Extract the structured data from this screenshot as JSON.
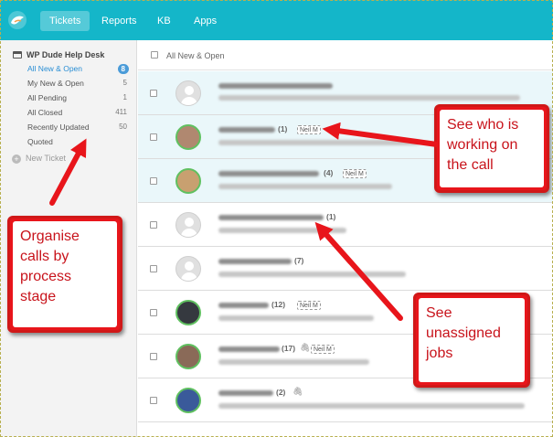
{
  "nav": {
    "tabs": [
      {
        "label": "Tickets"
      },
      {
        "label": "Reports"
      },
      {
        "label": "KB"
      },
      {
        "label": "Apps"
      }
    ]
  },
  "sidebar": {
    "helpdesk_name": "WP Dude Help Desk",
    "items": [
      {
        "label": "All New & Open",
        "count": "8"
      },
      {
        "label": "My New & Open",
        "count": "5"
      },
      {
        "label": "All Pending",
        "count": "1"
      },
      {
        "label": "All Closed",
        "count": "411"
      },
      {
        "label": "Recently Updated",
        "count": "50"
      },
      {
        "label": "Quoted",
        "count": ""
      }
    ],
    "new_ticket_label": "New Ticket"
  },
  "list": {
    "header_label": "All New & Open",
    "rows": [
      {
        "count": "",
        "agent": ""
      },
      {
        "count": "(1)",
        "agent": "Neil M"
      },
      {
        "count": "(4)",
        "agent": "Neil M"
      },
      {
        "count": "(1)",
        "agent": ""
      },
      {
        "count": "(7)",
        "agent": ""
      },
      {
        "count": "(12)",
        "agent": "Neil M"
      },
      {
        "count": "(17)",
        "agent": "Neil M"
      },
      {
        "count": "(2)",
        "agent": ""
      }
    ]
  },
  "annotations": {
    "callout_working": "See who is\nworking on\nthe call",
    "callout_stages": "Organise\ncalls by\nprocess\nstage",
    "callout_unassigned": "See\nunassigned\njobs"
  },
  "colors": {
    "topbar": "#14b6c9",
    "callout_red": "#e8151b",
    "selected_row": "#eaf7fa"
  }
}
